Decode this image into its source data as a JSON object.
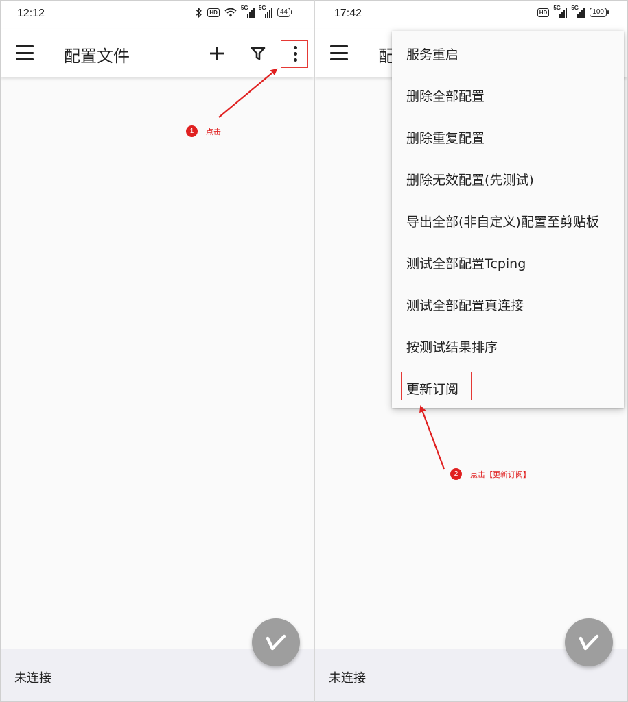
{
  "left_screen": {
    "status": {
      "time": "12:12",
      "battery": "44"
    },
    "toolbar": {
      "title": "配置文件"
    },
    "annotation": {
      "number": "1",
      "text": "点击"
    },
    "footer": {
      "text": "未连接"
    }
  },
  "right_screen": {
    "status": {
      "time": "17:42",
      "battery": "100"
    },
    "toolbar": {
      "title_partial": "配"
    },
    "menu": {
      "items": [
        "服务重启",
        "删除全部配置",
        "删除重复配置",
        "删除无效配置(先测试)",
        "导出全部(非自定义)配置至剪贴板",
        "测试全部配置Tcping",
        "测试全部配置真连接",
        "按测试结果排序",
        "更新订阅"
      ]
    },
    "annotation": {
      "number": "2",
      "text": "点击【更新订阅】"
    },
    "footer": {
      "text": "未连接"
    }
  },
  "colors": {
    "annotation_red": "#e02020",
    "fab_gray": "#9e9e9e",
    "footer_bg": "#efeff4",
    "content_bg": "#fafafa"
  },
  "icons": [
    "hamburger-icon",
    "add-icon",
    "filter-icon",
    "more-vert-icon",
    "v2ray-logo-icon",
    "bluetooth-icon",
    "wifi-icon",
    "signal-icon",
    "battery-icon"
  ]
}
